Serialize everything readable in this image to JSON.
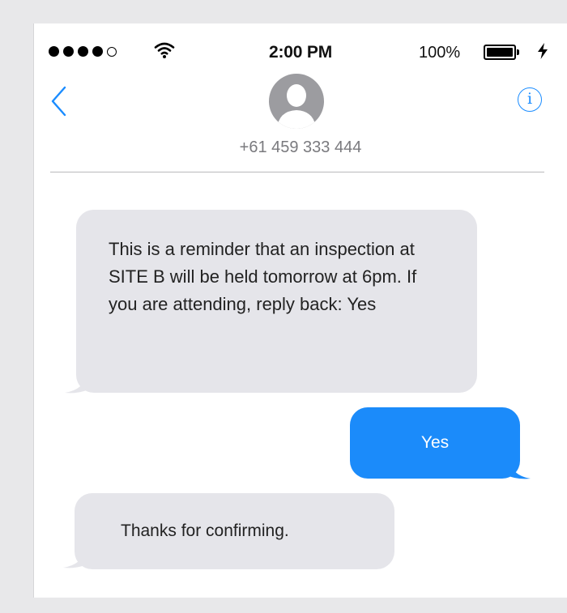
{
  "status_bar": {
    "signal_bars_filled": 4,
    "signal_bars_total": 5,
    "time": "2:00 PM",
    "battery_percent": "100%",
    "battery_level": 1.0
  },
  "header": {
    "back_icon": "chevron-left-icon",
    "info_label": "i",
    "contact": "+61 459 333 444",
    "accent_color": "#1a8cff"
  },
  "messages": [
    {
      "direction": "incoming",
      "text": "This is a reminder that an inspection at SITE B will be held tomorrow at 6pm. If you are attending, reply back: Yes"
    },
    {
      "direction": "outgoing",
      "text": "Yes"
    },
    {
      "direction": "incoming",
      "text": "Thanks for confirming."
    }
  ],
  "colors": {
    "incoming_bubble": "#e5e5ea",
    "outgoing_bubble": "#1b8bfa"
  }
}
